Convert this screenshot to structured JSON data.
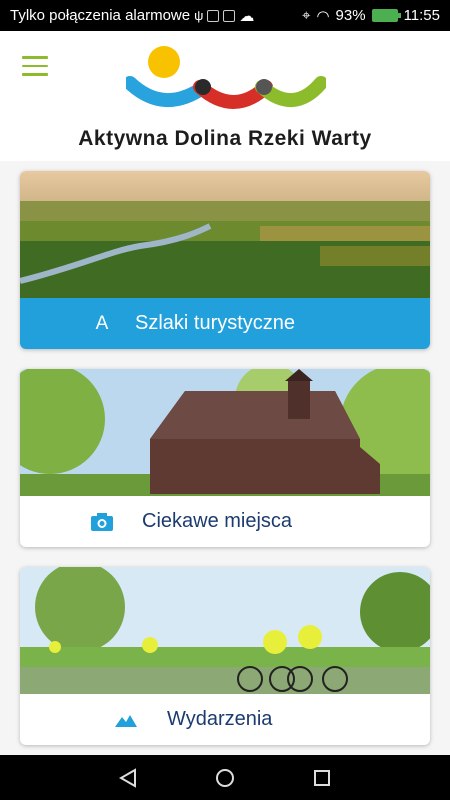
{
  "status_bar": {
    "carrier": "Tylko połączenia alarmowe",
    "battery_percent": "93%",
    "time": "11:55"
  },
  "header": {
    "title": "Aktywna Dolina Rzeki Warty",
    "logo_colors": [
      "#f9c200",
      "#29a3dd",
      "#d52f28",
      "#8cbc2b"
    ]
  },
  "cards": [
    {
      "label": "Szlaki turystyczne",
      "icon": "A",
      "icon_name": "trail-a-icon",
      "active": true
    },
    {
      "label": "Ciekawe miejsca",
      "icon": "camera",
      "icon_name": "camera-icon",
      "active": false
    },
    {
      "label": "Wydarzenia",
      "icon": "mountains",
      "icon_name": "mountains-icon",
      "active": false
    }
  ],
  "colors": {
    "accent": "#21a0dc",
    "label_text": "#1c3b6f",
    "menu_icon": "#8cbc2b"
  }
}
